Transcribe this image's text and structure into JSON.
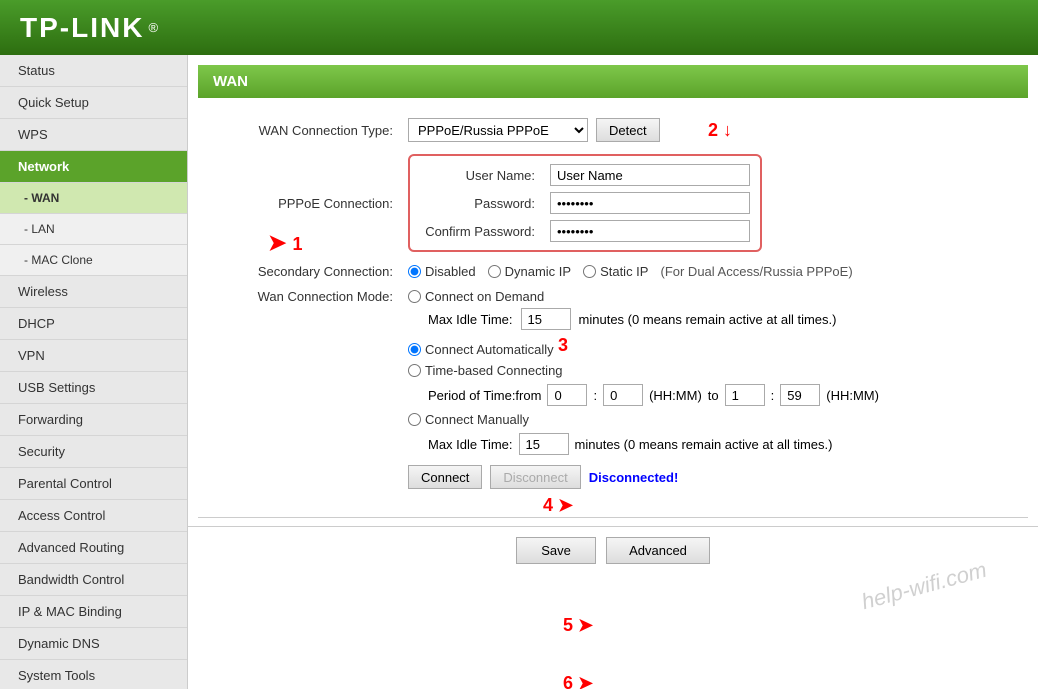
{
  "header": {
    "logo": "TP-LINK"
  },
  "sidebar": {
    "items": [
      {
        "label": "Status",
        "id": "status",
        "type": "top"
      },
      {
        "label": "Quick Setup",
        "id": "quick-setup",
        "type": "top"
      },
      {
        "label": "WPS",
        "id": "wps",
        "type": "top"
      },
      {
        "label": "Network",
        "id": "network",
        "type": "active"
      },
      {
        "label": "- WAN",
        "id": "wan",
        "type": "sub-active"
      },
      {
        "label": "- LAN",
        "id": "lan",
        "type": "sub"
      },
      {
        "label": "- MAC Clone",
        "id": "mac-clone",
        "type": "sub"
      },
      {
        "label": "Wireless",
        "id": "wireless",
        "type": "top"
      },
      {
        "label": "DHCP",
        "id": "dhcp",
        "type": "top"
      },
      {
        "label": "VPN",
        "id": "vpn",
        "type": "top"
      },
      {
        "label": "USB Settings",
        "id": "usb-settings",
        "type": "top"
      },
      {
        "label": "Forwarding",
        "id": "forwarding",
        "type": "top"
      },
      {
        "label": "Security",
        "id": "security",
        "type": "top"
      },
      {
        "label": "Parental Control",
        "id": "parental-control",
        "type": "top"
      },
      {
        "label": "Access Control",
        "id": "access-control",
        "type": "top"
      },
      {
        "label": "Advanced Routing",
        "id": "advanced-routing",
        "type": "top"
      },
      {
        "label": "Bandwidth Control",
        "id": "bandwidth-control",
        "type": "top"
      },
      {
        "label": "IP & MAC Binding",
        "id": "ip-mac-binding",
        "type": "top"
      },
      {
        "label": "Dynamic DNS",
        "id": "dynamic-dns",
        "type": "top"
      },
      {
        "label": "System Tools",
        "id": "system-tools",
        "type": "top"
      }
    ]
  },
  "main": {
    "section_title": "WAN",
    "wan_connection_type_label": "WAN Connection Type:",
    "wan_connection_type_value": "PPPoE/Russia PPPoE",
    "detect_button": "Detect",
    "pppoe_connection_label": "PPPoE Connection:",
    "username_label": "User Name:",
    "username_value": "User Name",
    "password_label": "Password:",
    "password_value": "••••••••",
    "confirm_password_label": "Confirm Password:",
    "confirm_password_value": "••••••••",
    "secondary_connection_label": "Secondary Connection:",
    "secondary_disabled": "Disabled",
    "secondary_dynamic_ip": "Dynamic IP",
    "secondary_static_ip": "Static IP",
    "secondary_note": "(For Dual Access/Russia PPPoE)",
    "wan_connection_mode_label": "Wan Connection Mode:",
    "connect_on_demand": "Connect on Demand",
    "max_idle_time_label": "Max Idle Time:",
    "max_idle_time_value_1": "15",
    "max_idle_note_1": "minutes (0 means remain active at all times.)",
    "connect_automatically": "Connect Automatically",
    "time_based_connecting": "Time-based Connecting",
    "period_from_label": "Period of Time:from",
    "from_hh": "0",
    "from_mm": "0",
    "from_hhmm": "(HH:MM)",
    "to_label": "to",
    "to_hh": "1",
    "to_mm": "59",
    "to_hhmm": "(HH:MM)",
    "connect_manually": "Connect Manually",
    "max_idle_time_label_2": "Max Idle Time:",
    "max_idle_time_value_2": "15",
    "max_idle_note_2": "minutes (0 means remain active at all times.)",
    "connect_button": "Connect",
    "disconnect_button": "Disconnect",
    "status_text": "Disconnected!",
    "save_button": "Save",
    "advanced_button": "Advanced",
    "watermark": "help-wifi.com"
  }
}
